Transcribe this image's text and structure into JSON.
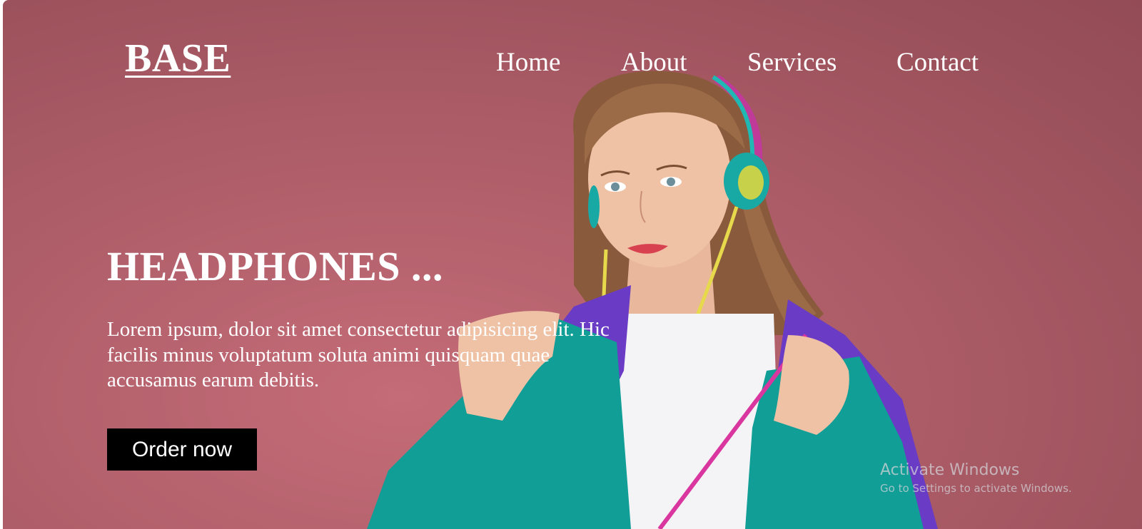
{
  "header": {
    "logo": "BASE",
    "nav": [
      {
        "label": "Home"
      },
      {
        "label": "About"
      },
      {
        "label": "Services"
      },
      {
        "label": "Contact"
      }
    ]
  },
  "hero": {
    "title": "HEADPHONES ...",
    "text": "Lorem ipsum, dolor sit amet consectetur adipisicing elit. Hic facilis minus voluptatum soluta animi quisquam quae accusamus earum debitis.",
    "button_label": "Order now",
    "image": "woman-with-headphones"
  },
  "watermark": {
    "title": "Activate Windows",
    "subtitle": "Go to Settings to activate Windows."
  },
  "colors": {
    "background": "#a85a65",
    "text": "#ffffff",
    "button_bg": "#000000",
    "jacket_teal": "#119e96",
    "jacket_purple": "#6a3bc4",
    "headphones": "#1fb8b3"
  }
}
